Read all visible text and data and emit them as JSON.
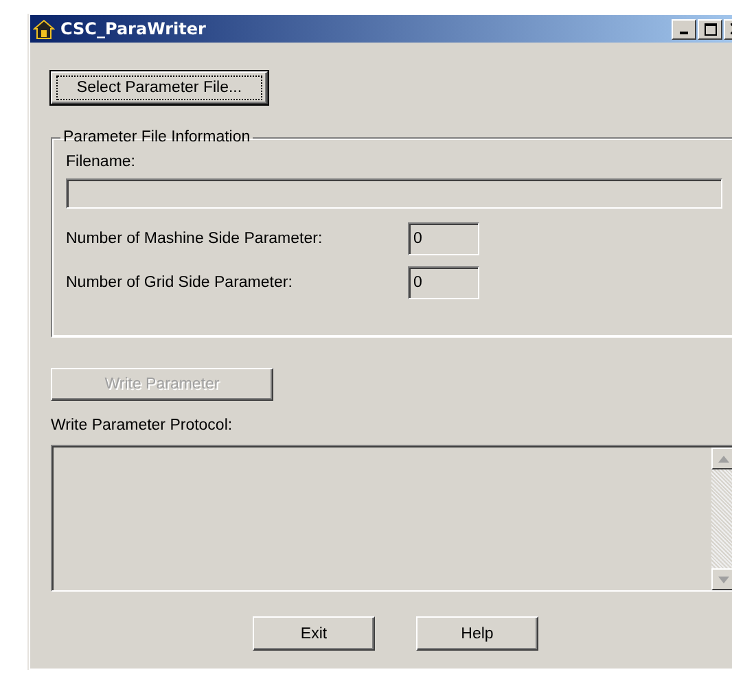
{
  "window": {
    "title": "CSC_ParaWriter"
  },
  "select_button": {
    "label": "Select Parameter File...",
    "focused": true
  },
  "group": {
    "title": "Parameter File Information",
    "filename": {
      "label": "Filename:"
    },
    "fields": [
      {
        "label": "Number of Mashine Side Parameter:",
        "value": "0"
      },
      {
        "label": "Number of Grid Side Parameter:",
        "value": "0"
      }
    ]
  },
  "write_button": {
    "label": "Write Parameter",
    "disabled": true
  },
  "protocol": {
    "label": "Write Parameter Protocol:"
  },
  "buttons": [
    {
      "label": "Exit"
    },
    {
      "label": "Help"
    }
  ]
}
